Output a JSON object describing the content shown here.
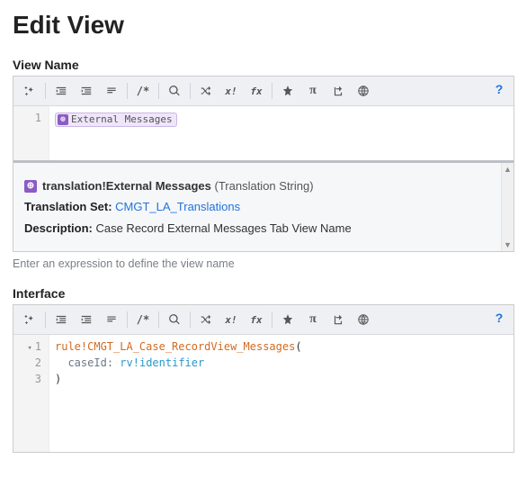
{
  "page": {
    "title": "Edit View",
    "hint": "Enter an expression to define the view name"
  },
  "sections": {
    "viewName": {
      "label": "View Name"
    },
    "interface": {
      "label": "Interface"
    }
  },
  "toolbar": {
    "icons": [
      "sparkle",
      "outdent",
      "indent",
      "format",
      "comment",
      "search",
      "shuffle",
      "overwrite",
      "fx",
      "star",
      "pi",
      "export",
      "globe"
    ]
  },
  "viewNameEditor": {
    "lines": [
      "1"
    ],
    "token": {
      "label": "External Messages",
      "kind": "translation"
    }
  },
  "infoPanel": {
    "titlePrefix": "translation!",
    "titleName": "External Messages",
    "titleType": "(Translation String)",
    "setLabel": "Translation Set",
    "setValue": "CMGT_LA_Translations",
    "descLabel": "Description",
    "descValue": "Case Record External Messages Tab View Name"
  },
  "interfaceEditor": {
    "lines": [
      "1",
      "2",
      "3"
    ],
    "rulePrefix": "rule!",
    "ruleName": "CMGT_LA_Case_RecordView_Messages",
    "paramKey": "caseId",
    "rvPrefix": "rv!",
    "rvName": "identifier"
  }
}
